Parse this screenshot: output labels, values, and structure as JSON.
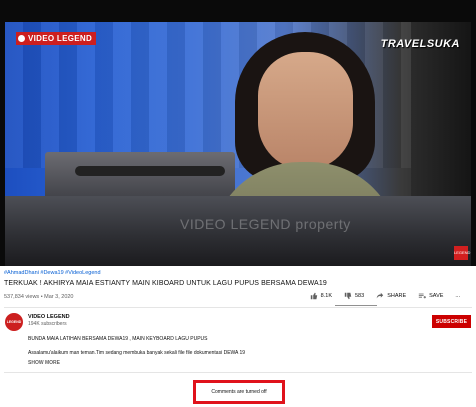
{
  "video": {
    "channel_watermark": "VIDEO LEGEND",
    "brand_overlay": "TRAVELSUKA",
    "overlay_text": "VIDEO LEGEND property",
    "corner_badge": "LEGEND"
  },
  "meta": {
    "hashtags": "#AhmadDhani #Dewa19 #VideoLegend",
    "title": "TERKUAK ! AKHIRYA MAIA ESTIANTY MAIN KIBOARD UNTUK LAGU PUPUS BERSAMA DEWA19",
    "views": "537,834 views • Mar 3, 2020",
    "likes": "8.1K",
    "dislikes": "583",
    "share_label": "SHARE",
    "save_label": "SAVE",
    "more_label": "..."
  },
  "channel": {
    "avatar_text": "LEGEND",
    "name": "VIDEO LEGEND",
    "subscribers": "194K subscribers",
    "subscribe_label": "SUBSCRIBE"
  },
  "description": {
    "line1": "BUNDA MAIA LATIHAN BERSAMA DEWA19 , MAIN KEYBOARD LAGU PUPUS",
    "line2": "Assalamu'alaikum man teman.Tim sedang membuka banyak sekali file file dokumentasi DEWA 19",
    "show_more": "SHOW MORE"
  },
  "comments": {
    "status": "Comments are turned off"
  },
  "colors": {
    "accent_red": "#cc0000",
    "link_blue": "#065fd4",
    "highlight_box": "#e0121b"
  }
}
